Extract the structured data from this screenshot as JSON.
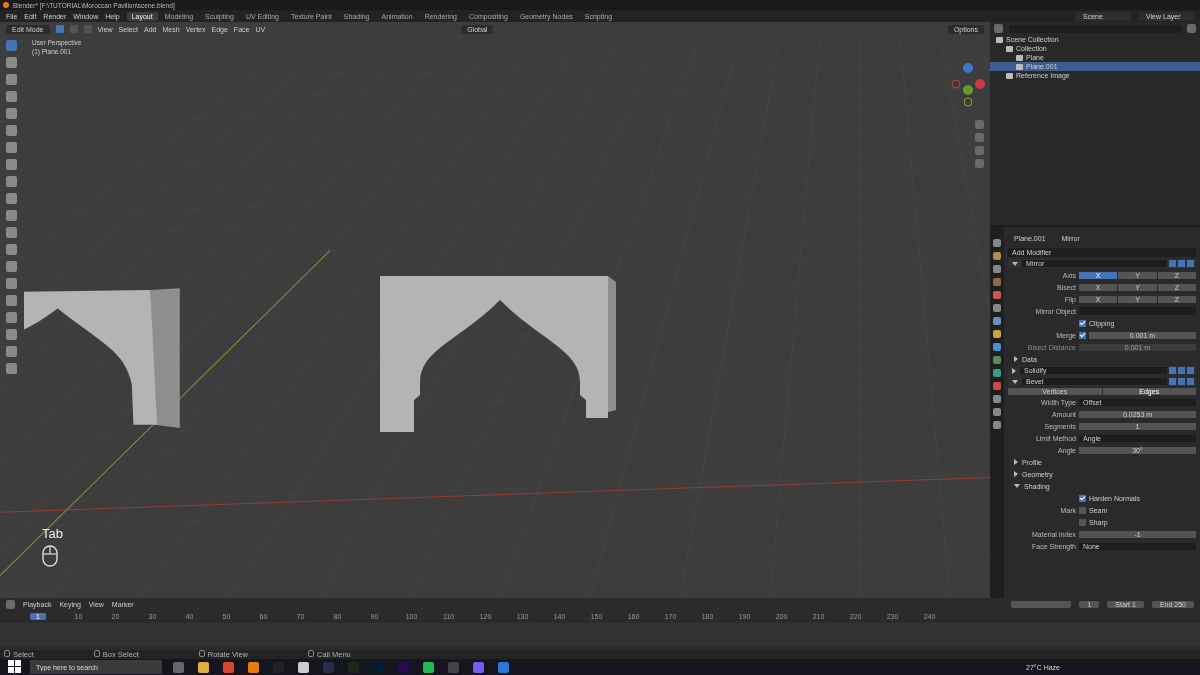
{
  "window": {
    "title": "Blender* [F:\\TUTORIAL\\Moroccan Pavilion\\scene.blend]"
  },
  "menu": [
    "File",
    "Edit",
    "Render",
    "Window",
    "Help"
  ],
  "workspaces": [
    {
      "label": "Layout",
      "selected": true
    },
    {
      "label": "Modeling",
      "selected": false
    },
    {
      "label": "Sculpting",
      "selected": false
    },
    {
      "label": "UV Editing",
      "selected": false
    },
    {
      "label": "Texture Paint",
      "selected": false
    },
    {
      "label": "Shading",
      "selected": false
    },
    {
      "label": "Animation",
      "selected": false
    },
    {
      "label": "Rendering",
      "selected": false
    },
    {
      "label": "Compositing",
      "selected": false
    },
    {
      "label": "Geometry Nodes",
      "selected": false
    },
    {
      "label": "Scripting",
      "selected": false
    }
  ],
  "scene": "Scene",
  "view_layer": "View Layer",
  "viewport": {
    "mode": "Edit Mode",
    "select_modes": [
      {
        "selected": true
      },
      {
        "selected": false
      },
      {
        "selected": false
      }
    ],
    "menus": [
      "View",
      "Select",
      "Add",
      "Mesh",
      "Vertex",
      "Edge",
      "Face",
      "UV"
    ],
    "orientation": "Global",
    "options": "Options",
    "info": [
      "User Perspective",
      "(1) Plane.001"
    ],
    "key_hint": "Tab"
  },
  "outliner": {
    "items": [
      {
        "label": "Scene Collection",
        "selected": false,
        "children": [
          {
            "label": "Collection",
            "selected": false,
            "children": [
              {
                "label": "Plane",
                "selected": false
              },
              {
                "label": "Plane.001",
                "selected": true
              }
            ]
          },
          {
            "label": "Reference Image",
            "selected": false
          }
        ]
      }
    ]
  },
  "properties": {
    "breadcrumb": [
      "Plane.001",
      "Mirror"
    ],
    "add_modifier": "Add Modifier",
    "modifiers": [
      {
        "name": "Mirror",
        "expanded": true,
        "rows": [
          {
            "kind": "toggles",
            "label": "Axis",
            "options": [
              {
                "label": "X",
                "selected": true
              },
              {
                "label": "Y",
                "selected": false
              },
              {
                "label": "Z",
                "selected": false
              }
            ]
          },
          {
            "kind": "toggles",
            "label": "Bisect",
            "options": [
              {
                "label": "X",
                "selected": false
              },
              {
                "label": "Y",
                "selected": false
              },
              {
                "label": "Z",
                "selected": false
              }
            ]
          },
          {
            "kind": "toggles",
            "label": "Flip",
            "options": [
              {
                "label": "X",
                "selected": false
              },
              {
                "label": "Y",
                "selected": false
              },
              {
                "label": "Z",
                "selected": false
              }
            ]
          },
          {
            "kind": "object",
            "label": "Mirror Object"
          },
          {
            "kind": "check",
            "text": "Clipping",
            "checked": true
          },
          {
            "kind": "number",
            "label": "Merge",
            "checked": true,
            "value": "0.001 m"
          },
          {
            "kind": "number",
            "label": "Bisect Distance",
            "value": "0.001 m",
            "disabled": true
          },
          {
            "kind": "subpanel",
            "label": "Data",
            "expanded": false
          }
        ]
      },
      {
        "name": "Solidify",
        "expanded": false
      },
      {
        "name": "Bevel",
        "expanded": true,
        "rows": [
          {
            "kind": "tabs",
            "options": [
              {
                "label": "Vertices",
                "selected": false
              },
              {
                "label": "Edges",
                "selected": true
              }
            ]
          },
          {
            "kind": "dropdown",
            "label": "Width Type",
            "value": "Offset"
          },
          {
            "kind": "number",
            "label": "Amount",
            "value": "0.0253 m"
          },
          {
            "kind": "number",
            "label": "Segments",
            "value": "1"
          },
          {
            "kind": "dropdown",
            "label": "Limit Method",
            "value": "Angle"
          },
          {
            "kind": "number",
            "label": "Angle",
            "value": "30°"
          },
          {
            "kind": "subpanel",
            "label": "Profile",
            "expanded": false
          },
          {
            "kind": "subpanel",
            "label": "Geometry",
            "expanded": false
          },
          {
            "kind": "subpanel",
            "label": "Shading",
            "expanded": true
          },
          {
            "kind": "check",
            "text": "Harden Normals",
            "checked": true
          },
          {
            "kind": "check",
            "label": "Mark",
            "text": "Seam",
            "checked": false
          },
          {
            "kind": "check",
            "text": "Sharp",
            "checked": false
          },
          {
            "kind": "number",
            "label": "Material Index",
            "value": "-1"
          },
          {
            "kind": "dropdown",
            "label": "Face Strength",
            "value": "None"
          }
        ]
      }
    ]
  },
  "timeline": {
    "menus": [
      "Playback",
      "Keying",
      "View",
      "Marker"
    ],
    "current_frame": "1",
    "start_label": "Start",
    "start": "1",
    "end_label": "End",
    "end": "250",
    "ruler": [
      "1",
      "10",
      "20",
      "30",
      "40",
      "50",
      "60",
      "70",
      "80",
      "90",
      "100",
      "110",
      "120",
      "130",
      "140",
      "150",
      "160",
      "170",
      "180",
      "190",
      "200",
      "210",
      "220",
      "230",
      "240"
    ]
  },
  "status_bar": [
    "Select",
    "Box Select",
    "Rotate View",
    "Call Menu"
  ],
  "taskbar": {
    "search_placeholder": "Type here to search",
    "temperature": "27°C",
    "weather": "Haze"
  }
}
